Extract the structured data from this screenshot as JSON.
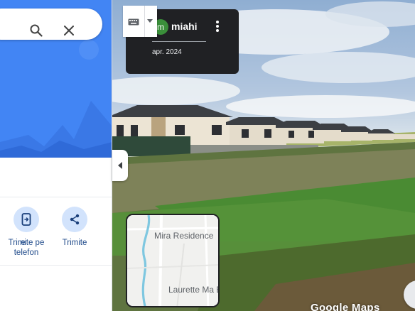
{
  "panel": {
    "search": {
      "value": ""
    },
    "actions": [
      {
        "label": "e"
      },
      {
        "label": "Trimite pe telefon"
      },
      {
        "label": "Trimite"
      }
    ]
  },
  "photo": {
    "author": "miahi",
    "avatar_letter": "m",
    "date": "apr. 2024"
  },
  "minimap": {
    "label_top": "Mira Residence",
    "label_bottom": "Laurette Ma Beauty De"
  },
  "brand": {
    "wordmark": "Google Maps"
  },
  "colors": {
    "hero_blue": "#4285f4",
    "action_circle": "#d2e3fc",
    "card_bg": "#202124",
    "avatar": "#3a8f3a"
  },
  "icons": [
    "search-icon",
    "close-icon",
    "phone-send-icon",
    "share-icon",
    "keyboard-icon",
    "chevron-down-icon",
    "chevron-left-icon",
    "more-vert-icon"
  ]
}
